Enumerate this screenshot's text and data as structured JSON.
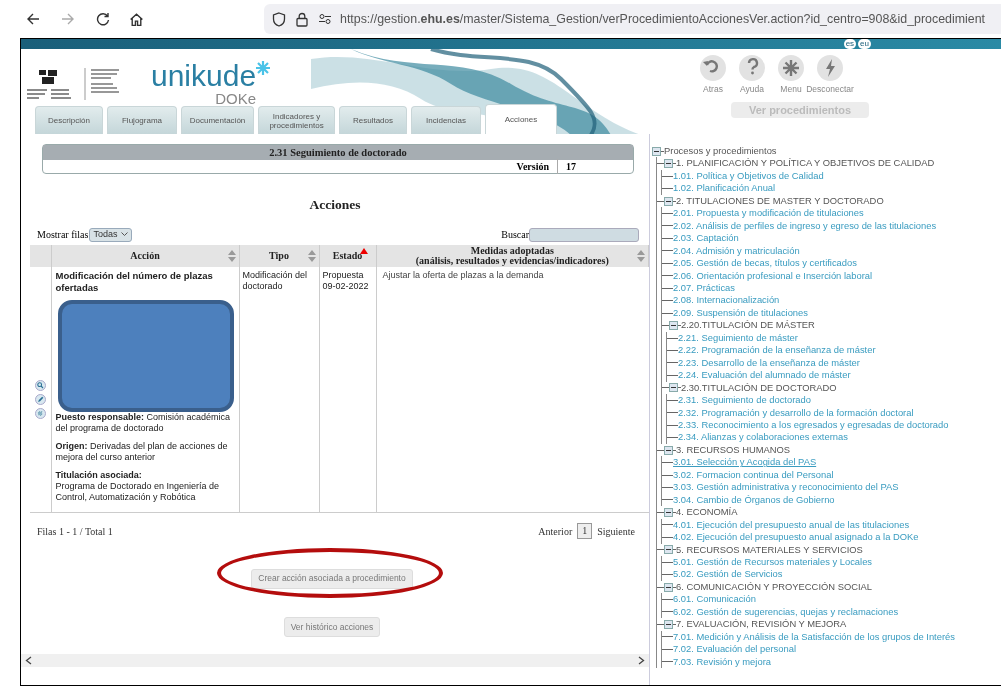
{
  "browser": {
    "url": "https://gestion.**ehu.es**/master/Sistema_Gestion/verProcedimientoAccionesVer.action?id_centro=908&id_procedimient"
  },
  "languages": [
    "es",
    "eu"
  ],
  "logo": {
    "brand": "unikude",
    "sub": "DOKe"
  },
  "toolbar": [
    {
      "kind": "back",
      "label": "Atras"
    },
    {
      "kind": "help",
      "label": "Ayuda"
    },
    {
      "kind": "menu",
      "label": "Menu"
    },
    {
      "kind": "disconnect",
      "label": "Desconectar"
    }
  ],
  "ver_procedimientos": "Ver procedimientos",
  "tabs": [
    {
      "label": "Descripción",
      "selected": false
    },
    {
      "label": "Flujograma",
      "selected": false
    },
    {
      "label": "Documentación",
      "selected": false
    },
    {
      "label": "Indicadores y procedimientos",
      "selected": false
    },
    {
      "label": "Resultados",
      "selected": false
    },
    {
      "label": "Incidencias",
      "selected": false
    },
    {
      "label": "Acciones",
      "selected": true
    }
  ],
  "procedure": {
    "title": "2.31 Seguimiento de doctorado",
    "version_label": "Versión",
    "version": "17"
  },
  "heading": "Acciones",
  "show_rows": {
    "label": "Mostrar filas",
    "value": "Todas"
  },
  "search": {
    "label": "Buscar"
  },
  "table": {
    "columns": [
      {
        "label": "Acción",
        "sorted": false
      },
      {
        "label": "Tipo",
        "sorted": false
      },
      {
        "label": "Estado",
        "sorted": true
      },
      {
        "label": "Medidas adoptadas",
        "sublabel": "(análisis, resultados y evidencias/indicadores)",
        "sorted": false
      }
    ],
    "rows": [
      {
        "title": "Modificación del número de plazas ofertadas",
        "redacted": true,
        "fields": [
          {
            "kind": "inline",
            "label": "Puesto responsable:",
            "value": "Comisión académica del programa de doctorado"
          },
          {
            "kind": "inline",
            "label": "Origen:",
            "value": "Derivadas del plan de acciones de mejora del curso anterior"
          },
          {
            "kind": "stacked",
            "label": "Titulación asociada:",
            "value": "Programa de Doctorado en Ingeniería de Control, Automatización y Robótica"
          }
        ],
        "tipo": "Modificación del doctorado",
        "estado": "Propuesta",
        "fecha": "09-02-2022",
        "medidas": "Ajustar la oferta de plazas a la demanda"
      }
    ]
  },
  "footer": {
    "count": "Filas 1 - 1 / Total 1",
    "prev": "Anterior",
    "page": "1",
    "next": "Siguiente"
  },
  "buttons": [
    {
      "label": "Crear acción asociada a procedimiento",
      "highlighted": true
    },
    {
      "label": "Ver histórico acciones",
      "highlighted": false
    }
  ],
  "tree": {
    "kind": "group",
    "label": "Procesos y procedimientos",
    "expanded": true,
    "children": [
      {
        "kind": "group",
        "label": "1. PLANIFICACIÓN Y POLÍTICA Y OBJETIVOS DE CALIDAD",
        "expanded": true,
        "children": [
          {
            "kind": "link",
            "label": "1.01. Política y Objetivos de Calidad",
            "hovered": false
          },
          {
            "kind": "link",
            "label": "1.02. Planificación Anual",
            "hovered": false
          }
        ]
      },
      {
        "kind": "group",
        "label": "2. TITULACIONES DE MASTER Y DOCTORADO",
        "expanded": true,
        "children": [
          {
            "kind": "link",
            "label": "2.01. Propuesta y modificación de titulaciones",
            "hovered": false
          },
          {
            "kind": "link",
            "label": "2.02. Análisis de perfiles de ingreso y egreso de las titulaciones",
            "hovered": false
          },
          {
            "kind": "link",
            "label": "2.03. Captación",
            "hovered": false
          },
          {
            "kind": "link",
            "label": "2.04. Admisión y matriculación",
            "hovered": false
          },
          {
            "kind": "link",
            "label": "2.05. Gestión de becas, títulos y certificados",
            "hovered": false
          },
          {
            "kind": "link",
            "label": "2.06. Orientación profesional e Inserción laboral",
            "hovered": false
          },
          {
            "kind": "link",
            "label": "2.07. Prácticas",
            "hovered": false
          },
          {
            "kind": "link",
            "label": "2.08. Internacionalización",
            "hovered": false
          },
          {
            "kind": "link",
            "label": "2.09. Suspensión de titulaciones",
            "hovered": false
          },
          {
            "kind": "group",
            "label": "2.20.TITULACIÓN DE MÁSTER",
            "expanded": true,
            "children": [
              {
                "kind": "link",
                "label": "2.21. Seguimiento de máster",
                "hovered": false
              },
              {
                "kind": "link",
                "label": "2.22. Programación de la enseñanza de máster",
                "hovered": false
              },
              {
                "kind": "link",
                "label": "2.23. Desarrollo de la enseñanza de máster",
                "hovered": false
              },
              {
                "kind": "link",
                "label": "2.24. Evaluación del alumnado de máster",
                "hovered": false
              }
            ]
          },
          {
            "kind": "group",
            "label": "2.30.TITULACIÓN DE DOCTORADO",
            "expanded": true,
            "children": [
              {
                "kind": "link",
                "label": "2.31. Seguimiento de doctorado",
                "hovered": false
              },
              {
                "kind": "link",
                "label": "2.32. Programación y desarrollo de la formación doctoral",
                "hovered": false
              },
              {
                "kind": "link",
                "label": "2.33. Reconocimiento a los egresados y egresadas de doctorado",
                "hovered": false
              },
              {
                "kind": "link",
                "label": "2.34. Alianzas y colaboraciones externas",
                "hovered": false
              }
            ]
          }
        ]
      },
      {
        "kind": "group",
        "label": "3. RECURSOS HUMANOS",
        "expanded": true,
        "children": [
          {
            "kind": "link",
            "label": "3.01. Selección y Acogida del PAS",
            "hovered": true
          },
          {
            "kind": "link",
            "label": "3.02. Formacion continua del Personal",
            "hovered": false
          },
          {
            "kind": "link",
            "label": "3.03. Gestión administrativa y reconocimiento del PAS",
            "hovered": false
          },
          {
            "kind": "link",
            "label": "3.04. Cambio de Órganos de Gobierno",
            "hovered": false
          }
        ]
      },
      {
        "kind": "group",
        "label": "4. ECONOMÍA",
        "expanded": true,
        "children": [
          {
            "kind": "link",
            "label": "4.01. Ejecución del presupuesto anual de las titulaciones",
            "hovered": false
          },
          {
            "kind": "link",
            "label": "4.02. Ejecución del presupuesto anual asignado a la DOKe",
            "hovered": false
          }
        ]
      },
      {
        "kind": "group",
        "label": "5. RECURSOS MATERIALES Y SERVICIOS",
        "expanded": true,
        "children": [
          {
            "kind": "link",
            "label": "5.01. Gestión de Recursos materiales y Locales",
            "hovered": false
          },
          {
            "kind": "link",
            "label": "5.02. Gestión de Servicios",
            "hovered": false
          }
        ]
      },
      {
        "kind": "group",
        "label": "6. COMUNICACIÓN Y PROYECCIÓN SOCIAL",
        "expanded": true,
        "children": [
          {
            "kind": "link",
            "label": "6.01. Comunicación",
            "hovered": false
          },
          {
            "kind": "link",
            "label": "6.02. Gestión de sugerencias, quejas y reclamaciones",
            "hovered": false
          }
        ]
      },
      {
        "kind": "group",
        "label": "7. EVALUACIÓN, REVISIÓN Y MEJORA",
        "expanded": true,
        "children": [
          {
            "kind": "link",
            "label": "7.01. Medición y Análisis de la Satisfacción de los grupos de Interés",
            "hovered": false
          },
          {
            "kind": "link",
            "label": "7.02. Evaluación del personal",
            "hovered": false
          },
          {
            "kind": "link",
            "label": "7.03. Revisión y mejora",
            "hovered": false
          }
        ]
      }
    ]
  }
}
